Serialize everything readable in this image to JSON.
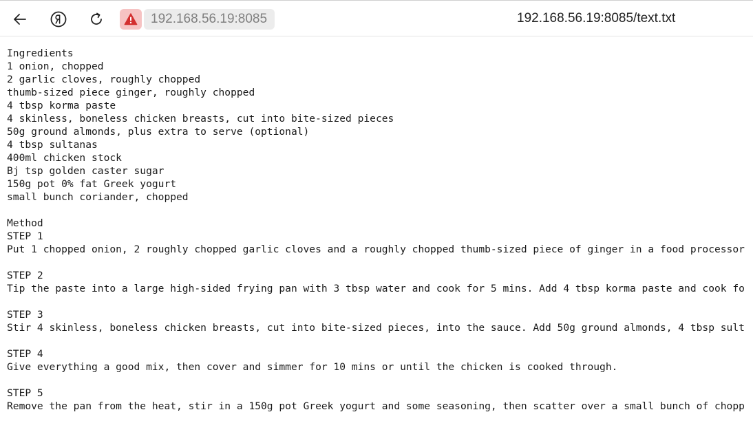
{
  "toolbar": {
    "back_icon": "arrow-left-icon",
    "browser_icon": "yandex-logo-icon",
    "reload_icon": "reload-icon",
    "security_icon": "warning-triangle-icon",
    "security_color": "#d32f2f",
    "address": "192.168.56.19:8085",
    "page_title": "192.168.56.19:8085/text.txt"
  },
  "document": {
    "lines": [
      "Ingredients",
      "1 onion, chopped",
      "2 garlic cloves, roughly chopped",
      "thumb-sized piece ginger, roughly chopped",
      "4 tbsp korma paste",
      "4 skinless, boneless chicken breasts, cut into bite-sized pieces",
      "50g ground almonds, plus extra to serve (optional)",
      "4 tbsp sultanas",
      "400ml chicken stock",
      "Bj tsp golden caster sugar",
      "150g pot 0% fat Greek yogurt",
      "small bunch coriander, chopped",
      "",
      "Method",
      "STEP 1",
      "Put 1 chopped onion, 2 roughly chopped garlic cloves and a roughly chopped thumb-sized piece of ginger in a food processor",
      "",
      "STEP 2",
      "Tip the paste into a large high-sided frying pan with 3 tbsp water and cook for 5 mins. Add 4 tbsp korma paste and cook fo",
      "",
      "STEP 3",
      "Stir 4 skinless, boneless chicken breasts, cut into bite-sized pieces, into the sauce. Add 50g ground almonds, 4 tbsp sult",
      "",
      "STEP 4",
      "Give everything a good mix, then cover and simmer for 10 mins or until the chicken is cooked through.",
      "",
      "STEP 5",
      "Remove the pan from the heat, stir in a 150g pot Greek yogurt and some seasoning, then scatter over a small bunch of chopp"
    ]
  }
}
